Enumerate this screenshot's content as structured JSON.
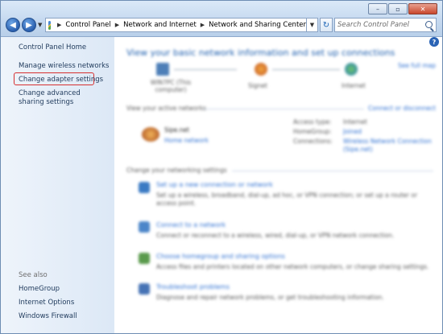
{
  "titlebar": {
    "minimize": "–",
    "maximize": "▫",
    "close": "✕"
  },
  "address": {
    "crumbs": [
      "Control Panel",
      "Network and Internet",
      "Network and Sharing Center"
    ],
    "search_placeholder": "Search Control Panel"
  },
  "sidebar": {
    "home": "Control Panel Home",
    "items": [
      "Manage wireless networks",
      "Change adapter settings",
      "Change advanced sharing settings"
    ],
    "see_also_label": "See also",
    "see_also": [
      "HomeGroup",
      "Internet Options",
      "Windows Firewall"
    ]
  },
  "main": {
    "heading": "View your basic network information and set up connections",
    "see_full_map": "See full map",
    "map_nodes": [
      "WIN7PC (This computer)",
      "Signet",
      "Internet"
    ],
    "active_networks_label": "View your active networks",
    "connect_disconnect": "Connect or disconnect",
    "network_name": "Sipe.net",
    "network_type": "Home network",
    "props": [
      {
        "k": "Access type:",
        "v": "Internet"
      },
      {
        "k": "HomeGroup:",
        "v": "Joined"
      },
      {
        "k": "Connections:",
        "v": "Wireless Network Connection (Sipe.net)"
      }
    ],
    "change_settings_label": "Change your networking settings",
    "tasks": [
      {
        "title": "Set up a new connection or network",
        "desc": "Set up a wireless, broadband, dial-up, ad hoc, or VPN connection; or set up a router or access point."
      },
      {
        "title": "Connect to a network",
        "desc": "Connect or reconnect to a wireless, wired, dial-up, or VPN network connection."
      },
      {
        "title": "Choose homegroup and sharing options",
        "desc": "Access files and printers located on other network computers, or change sharing settings."
      },
      {
        "title": "Troubleshoot problems",
        "desc": "Diagnose and repair network problems, or get troubleshooting information."
      }
    ]
  },
  "colors": {
    "link": "#1e395b",
    "highlight": "#d63030",
    "accent": "#1e5fae"
  }
}
